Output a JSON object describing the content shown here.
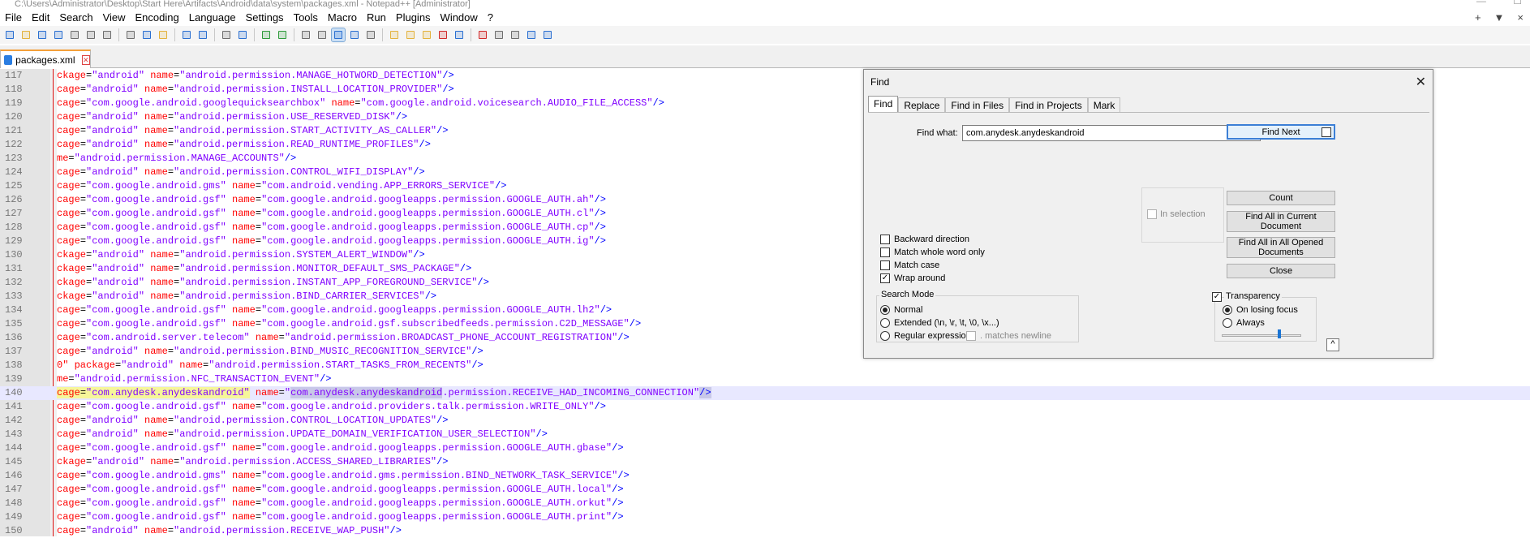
{
  "window": {
    "title": "C:\\Users\\Administrator\\Desktop\\Start Here\\Artifacts\\Android\\data\\system\\packages.xml - Notepad++ [Administrator]",
    "controls": [
      "—",
      "☐"
    ]
  },
  "menubar": {
    "items": [
      "File",
      "Edit",
      "Search",
      "View",
      "Encoding",
      "Language",
      "Settings",
      "Tools",
      "Macro",
      "Run",
      "Plugins",
      "Window",
      "?"
    ],
    "right": [
      "+",
      "▼",
      "×"
    ]
  },
  "toolbar": {
    "icons": [
      "new-file-icon",
      "open-file-icon",
      "save-icon",
      "save-all-icon",
      "close-icon",
      "close-all-icon",
      "print-icon",
      "sep",
      "cut-icon",
      "copy-icon",
      "paste-icon",
      "sep",
      "undo-icon",
      "redo-icon",
      "sep",
      "find-icon",
      "replace-icon",
      "sep",
      "zoom-in-icon",
      "zoom-out-icon",
      "sep",
      "sync-vertical-icon",
      "sync-horizontal-icon",
      "word-wrap-icon",
      "show-all-chars-icon",
      "indent-guide-icon",
      "sep",
      "user-defined-lang-icon",
      "doc-map-icon",
      "function-list-icon",
      "folder-workspace-icon",
      "monitoring-icon",
      "sep",
      "record-macro-icon",
      "stop-record-icon",
      "play-macro-icon",
      "play-multiple-icon",
      "save-macro-icon"
    ],
    "colors": {
      "blue": "#2a6fd1",
      "green": "#2e9b3a",
      "red": "#d12a2a",
      "gray": "#6d6d6d",
      "yellow": "#e3b23c"
    }
  },
  "tabs": [
    {
      "label": "packages.xml"
    }
  ],
  "editor": {
    "current_line": 140,
    "lines": [
      {
        "n": "117",
        "pre": "ckage",
        "a": "\"android\"",
        "b": "\"android.permission.MANAGE_HOTWORD_DETECTION\""
      },
      {
        "n": "118",
        "pre": "cage",
        "a": "\"android\"",
        "b": "\"android.permission.INSTALL_LOCATION_PROVIDER\""
      },
      {
        "n": "119",
        "pre": "cage",
        "a": "\"com.google.android.googlequicksearchbox\"",
        "b": "\"com.google.android.voicesearch.AUDIO_FILE_ACCESS\""
      },
      {
        "n": "120",
        "pre": "cage",
        "a": "\"android\"",
        "b": "\"android.permission.USE_RESERVED_DISK\""
      },
      {
        "n": "121",
        "pre": "cage",
        "a": "\"android\"",
        "b": "\"android.permission.START_ACTIVITY_AS_CALLER\""
      },
      {
        "n": "122",
        "pre": "cage",
        "a": "\"android\"",
        "b": "\"android.permission.READ_RUNTIME_PROFILES\""
      },
      {
        "n": "123",
        "pre": "me",
        "a": "\"android.permission.MANAGE_ACCOUNTS\"",
        "b": ""
      },
      {
        "n": "124",
        "pre": "cage",
        "a": "\"android\"",
        "b": "\"android.permission.CONTROL_WIFI_DISPLAY\""
      },
      {
        "n": "125",
        "pre": "cage",
        "a": "\"com.google.android.gms\"",
        "b": "\"com.android.vending.APP_ERRORS_SERVICE\""
      },
      {
        "n": "126",
        "pre": "cage",
        "a": "\"com.google.android.gsf\"",
        "b": "\"com.google.android.googleapps.permission.GOOGLE_AUTH.ah\""
      },
      {
        "n": "127",
        "pre": "cage",
        "a": "\"com.google.android.gsf\"",
        "b": "\"com.google.android.googleapps.permission.GOOGLE_AUTH.cl\""
      },
      {
        "n": "128",
        "pre": "cage",
        "a": "\"com.google.android.gsf\"",
        "b": "\"com.google.android.googleapps.permission.GOOGLE_AUTH.cp\""
      },
      {
        "n": "129",
        "pre": "cage",
        "a": "\"com.google.android.gsf\"",
        "b": "\"com.google.android.googleapps.permission.GOOGLE_AUTH.ig\""
      },
      {
        "n": "130",
        "pre": "ckage",
        "a": "\"android\"",
        "b": "\"android.permission.SYSTEM_ALERT_WINDOW\""
      },
      {
        "n": "131",
        "pre": "ckage",
        "a": "\"android\"",
        "b": "\"android.permission.MONITOR_DEFAULT_SMS_PACKAGE\""
      },
      {
        "n": "132",
        "pre": "ckage",
        "a": "\"android\"",
        "b": "\"android.permission.INSTANT_APP_FOREGROUND_SERVICE\""
      },
      {
        "n": "133",
        "pre": "ckage",
        "a": "\"android\"",
        "b": "\"android.permission.BIND_CARRIER_SERVICES\""
      },
      {
        "n": "134",
        "pre": "cage",
        "a": "\"com.google.android.gsf\"",
        "b": "\"com.google.android.googleapps.permission.GOOGLE_AUTH.lh2\""
      },
      {
        "n": "135",
        "pre": "cage",
        "a": "\"com.google.android.gsf\"",
        "b": "\"com.google.android.gsf.subscribedfeeds.permission.C2D_MESSAGE\""
      },
      {
        "n": "136",
        "pre": "cage",
        "a": "\"com.android.server.telecom\"",
        "b": "\"android.permission.BROADCAST_PHONE_ACCOUNT_REGISTRATION\""
      },
      {
        "n": "137",
        "pre": "cage",
        "a": "\"android\"",
        "b": "\"android.permission.BIND_MUSIC_RECOGNITION_SERVICE\""
      },
      {
        "n": "138",
        "pre": "0\" package",
        "a": "\"android\"",
        "b": "\"android.permission.START_TASKS_FROM_RECENTS\""
      },
      {
        "n": "139",
        "pre": "me",
        "a": "\"android.permission.NFC_TRANSACTION_EVENT\"",
        "b": ""
      },
      {
        "n": "140",
        "pre": "cage",
        "a": "\"com.anydesk.anydeskandroid\"",
        "b": "\"com.anydesk.anydeskandroid.permission.RECEIVE_HAD_INCOMING_CONNECTION\""
      },
      {
        "n": "141",
        "pre": "cage",
        "a": "\"com.google.android.gsf\"",
        "b": "\"com.google.android.providers.talk.permission.WRITE_ONLY\""
      },
      {
        "n": "142",
        "pre": "cage",
        "a": "\"android\"",
        "b": "\"android.permission.CONTROL_LOCATION_UPDATES\""
      },
      {
        "n": "143",
        "pre": "cage",
        "a": "\"android\"",
        "b": "\"android.permission.UPDATE_DOMAIN_VERIFICATION_USER_SELECTION\""
      },
      {
        "n": "144",
        "pre": "cage",
        "a": "\"com.google.android.gsf\"",
        "b": "\"com.google.android.googleapps.permission.GOOGLE_AUTH.gbase\""
      },
      {
        "n": "145",
        "pre": "ckage",
        "a": "\"android\"",
        "b": "\"android.permission.ACCESS_SHARED_LIBRARIES\""
      },
      {
        "n": "146",
        "pre": "cage",
        "a": "\"com.google.android.gms\"",
        "b": "\"com.google.android.gms.permission.BIND_NETWORK_TASK_SERVICE\""
      },
      {
        "n": "147",
        "pre": "cage",
        "a": "\"com.google.android.gsf\"",
        "b": "\"com.google.android.googleapps.permission.GOOGLE_AUTH.local\""
      },
      {
        "n": "148",
        "pre": "cage",
        "a": "\"com.google.android.gsf\"",
        "b": "\"com.google.android.googleapps.permission.GOOGLE_AUTH.orkut\""
      },
      {
        "n": "149",
        "pre": "cage",
        "a": "\"com.google.android.gsf\"",
        "b": "\"com.google.android.googleapps.permission.GOOGLE_AUTH.print\""
      },
      {
        "n": "150",
        "pre": "cage",
        "a": "\"android\"",
        "b": "\"android.permission.RECEIVE_WAP_PUSH\""
      }
    ]
  },
  "find_dialog": {
    "title": "Find",
    "close": "✕",
    "tabs": [
      "Find",
      "Replace",
      "Find in Files",
      "Find in Projects",
      "Mark"
    ],
    "find_what_label": "Find what:",
    "find_what_value": "com.anydesk.anydeskandroid",
    "dropdown_arrow": "⌵",
    "in_selection": "In selection",
    "options": {
      "backward": "Backward direction",
      "whole_word": "Match whole word only",
      "match_case": "Match case",
      "wrap_around": "Wrap around",
      "wrap_around_checked": "✓"
    },
    "buttons": {
      "find_next": "Find Next",
      "count": "Count",
      "find_all_current": "Find All in Current Document",
      "find_all_opened": "Find All in All Opened Documents",
      "close": "Close"
    },
    "search_mode": {
      "title": "Search Mode",
      "normal": "Normal",
      "extended": "Extended (\\n, \\r, \\t, \\0, \\x...)",
      "regex": "Regular expression",
      "matches_newline": ". matches newline"
    },
    "transparency": {
      "label": "Transparency",
      "checked_mark": "✓",
      "on_losing_focus": "On losing focus",
      "always": "Always",
      "slider_level": 0.72
    },
    "collapse": "^"
  }
}
